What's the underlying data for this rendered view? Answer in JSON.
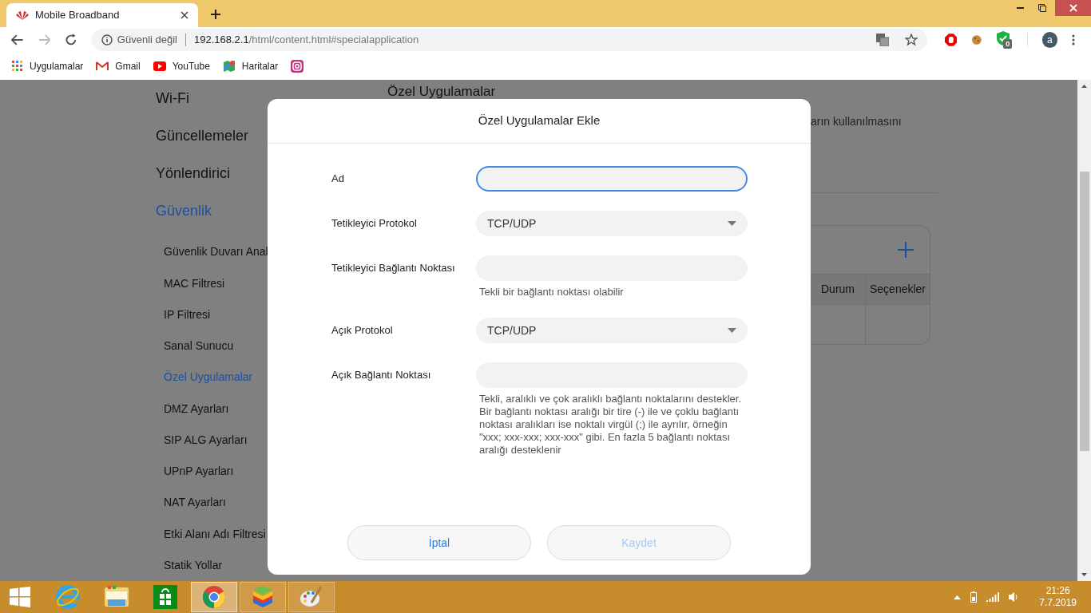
{
  "browser": {
    "tab": {
      "title": "Mobile Broadband"
    },
    "security": "Güvenli değil",
    "url_host": "192.168.2.1",
    "url_path": "/html/content.html#specialapplication",
    "extension_badge": "0",
    "avatar": "a",
    "bookmarks": [
      {
        "kind": "apps",
        "label": "Uygulamalar"
      },
      {
        "kind": "gmail",
        "label": "Gmail"
      },
      {
        "kind": "youtube",
        "label": "YouTube"
      },
      {
        "kind": "maps",
        "label": "Haritalar"
      },
      {
        "kind": "instagram"
      }
    ]
  },
  "sidebar": {
    "items": [
      {
        "kind": "section",
        "label": "Wi-Fi",
        "selected": false
      },
      {
        "kind": "section",
        "label": "Güncellemeler",
        "selected": false
      },
      {
        "kind": "section",
        "label": "Yönlendirici",
        "selected": false
      },
      {
        "kind": "section",
        "label": "Güvenlik",
        "selected": true
      },
      {
        "kind": "item",
        "label": "Güvenlik Duvarı Anal",
        "selected": false
      },
      {
        "kind": "item",
        "label": "MAC Filtresi",
        "selected": false
      },
      {
        "kind": "item",
        "label": "IP Filtresi",
        "selected": false
      },
      {
        "kind": "item",
        "label": "Sanal Sunucu",
        "selected": false
      },
      {
        "kind": "item",
        "label": "Özel Uygulamalar",
        "selected": true
      },
      {
        "kind": "item",
        "label": "DMZ Ayarları",
        "selected": false
      },
      {
        "kind": "item",
        "label": "SIP ALG Ayarları",
        "selected": false
      },
      {
        "kind": "item",
        "label": "UPnP Ayarları",
        "selected": false
      },
      {
        "kind": "item",
        "label": "NAT Ayarları",
        "selected": false
      },
      {
        "kind": "item",
        "label": "Etki Alanı Adı Filtresi",
        "selected": false
      },
      {
        "kind": "item",
        "label": "Statik Yollar",
        "selected": false
      }
    ]
  },
  "page": {
    "heading": "Özel Uygulamalar",
    "description": "arın kullanılmasını",
    "table": {
      "columns": [
        "Durum",
        "Seçenekler"
      ]
    }
  },
  "modal": {
    "title": "Özel Uygulamalar Ekle",
    "fields": [
      {
        "kind": "text",
        "label": "Ad",
        "focused": true
      },
      {
        "kind": "select",
        "label": "Tetikleyici Protokol",
        "value": "TCP/UDP"
      },
      {
        "kind": "text",
        "label": "Tetikleyici Bağlantı Noktası",
        "focused": false,
        "hint": "Tekli bir bağlantı noktası olabilir"
      },
      {
        "kind": "select",
        "label": "Açık Protokol",
        "value": "TCP/UDP"
      },
      {
        "kind": "text",
        "label": "Açık Bağlantı Noktası",
        "focused": false,
        "hint": "Tekli, aralıklı ve çok aralıklı bağlantı noktalarını destekler. Bir bağlantı noktası aralığı bir tire (-) ile ve çoklu bağlantı noktası aralıkları ise noktalı virgül (;) ile ayrılır, örneğin \"xxx; xxx-xxx; xxx-xxx\" gibi. En fazla 5 bağlantı noktası aralığı desteklenir"
      }
    ],
    "buttons": [
      {
        "label": "İptal",
        "disabled": false
      },
      {
        "label": "Kaydet",
        "disabled": true
      }
    ]
  },
  "taskbar": {
    "apps": [
      {
        "kind": "ie",
        "active": false
      },
      {
        "kind": "explorer",
        "active": false
      },
      {
        "kind": "store",
        "active": false
      },
      {
        "kind": "chrome",
        "active": true
      },
      {
        "kind": "bluestacks",
        "active": false
      },
      {
        "kind": "paint",
        "active": false
      }
    ],
    "time": "21:26",
    "date": "7.7.2019"
  }
}
